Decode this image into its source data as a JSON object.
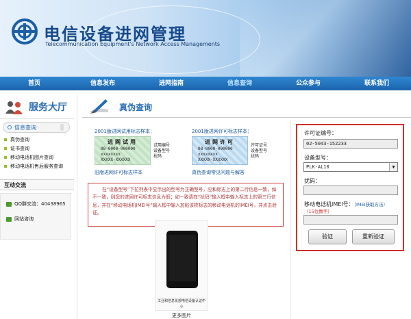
{
  "banner": {
    "title": "电信设备进网管理",
    "subtitle": "Telecommunication Equipment's Network Access Managements"
  },
  "nav": {
    "items": [
      "首页",
      "信息发布",
      "进网指南",
      "信息查询",
      "公众参与",
      "联系我们"
    ],
    "active_index": 3
  },
  "sidebar": {
    "service_title": "服务大厅",
    "category_tab": "信息查询",
    "menu": [
      "真伪查询",
      "证书查询",
      "移动电话机图片查询",
      "移动电话机售后服务查询"
    ],
    "interaction_title": "互动交流",
    "interaction_items": [
      {
        "label": "QQ群交流：40438965"
      },
      {
        "label": "网站咨询"
      }
    ]
  },
  "main": {
    "page_title": "真伪查询",
    "sample_trial": {
      "caption": "2001版进网试用标志样本：",
      "card_title": "进网试用",
      "card_lines": [
        "08-0000-000000",
        "xxxxxxxx",
        "XXXXX-XXXXXX"
      ],
      "legend": [
        "试用编号",
        "设备型号",
        "扰码"
      ],
      "link": "旧版进网许可标志样本"
    },
    "sample_license": {
      "caption": "2001版进网许可标志样本：",
      "card_title": "进网许可",
      "card_lines": [
        "08-0000-000000",
        "xxxxxxxx",
        "XXXXX-XXXXXX"
      ],
      "legend": [
        "许可证号",
        "设备型号",
        "扰码"
      ],
      "link": "真伪查询常见问题与解答"
    },
    "notice": "在“设备型号”下拉列表中显示出的型号为正确型号，应和标志上的第二行信息一致，如不一致，则您的进网许可标志信息为假；如一致请在“扰码”输入框中输入标志上的第三行信息，并在“移动电话机IMEI号”输入框中输入加贴该枚标志的移动电话机的IMEI号，并点击验证。",
    "phone_caption": "工业和信息化部电信设备认证中心",
    "more_images": "更多图片"
  },
  "form": {
    "license_label": "许可证编号：",
    "license_value": "02-5043-152233",
    "model_label": "设备型号：",
    "model_value": "PLK-AL10",
    "scramble_label": "扰码：",
    "scramble_value": "",
    "imei_label": "移动电话机IMEI号：",
    "imei_hint": "（IMEI获取方法）",
    "imei_digits": "（15位数字）",
    "imei_value": "",
    "verify_button": "验证",
    "reverify_button": "重新验证"
  },
  "colors": {
    "nav_blue": "#1b64ab",
    "title_blue": "#174a8b",
    "accent_red": "#d32f2f"
  }
}
